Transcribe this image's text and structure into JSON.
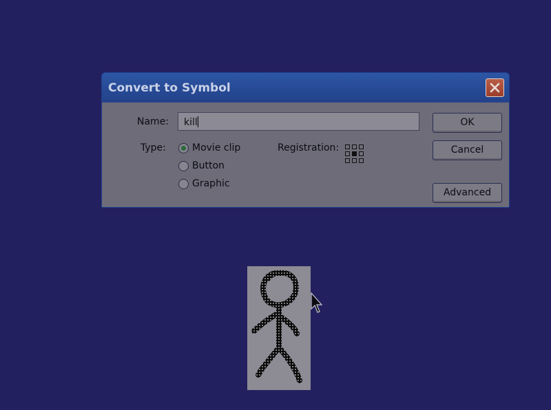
{
  "dialog": {
    "title": "Convert to Symbol",
    "name_label": "Name:",
    "name_value": "kill",
    "type_label": "Type:",
    "type_options": [
      {
        "label": "Movie clip",
        "selected": true
      },
      {
        "label": "Button",
        "selected": false
      },
      {
        "label": "Graphic",
        "selected": false
      }
    ],
    "registration_label": "Registration:",
    "buttons": {
      "ok": "OK",
      "cancel": "Cancel",
      "advanced": "Advanced"
    }
  },
  "icons": {
    "close": "close-icon",
    "cursor": "arrow-cursor-icon",
    "figure": "stick-figure-drawing"
  },
  "colors": {
    "desktop": "#23205f",
    "titlebar": "#284c98",
    "dialog_body": "#6d6c78",
    "close_button": "#a8472f"
  }
}
